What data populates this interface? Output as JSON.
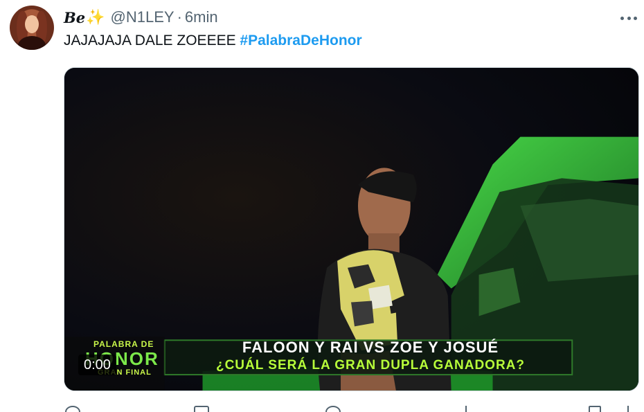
{
  "tweet": {
    "author": {
      "display_name": "Be",
      "emoji": "✨",
      "handle": "@N1LEY",
      "separator": "·",
      "time": "6min"
    },
    "text": "JAJAJAJA DALE ZOEEEE ",
    "hashtag": "#PalabraDeHonor",
    "media": {
      "type": "video",
      "timestamp": "0:00",
      "logo_top": "PALABRA DE",
      "logo_mid": "HONOR",
      "logo_bottom": "GRAN FINAL",
      "banner_line1": "FALOON Y RAI VS ZOE Y JOSUÉ",
      "banner_line2": "¿CUÁL SERÁ LA GRAN DUPLA GANADORA?"
    },
    "actions": {
      "reply_icon": "reply-icon",
      "retweet_icon": "retweet-icon",
      "like_icon": "heart-icon",
      "views_icon": "views-icon",
      "bookmark_icon": "bookmark-icon",
      "share_icon": "share-icon"
    }
  },
  "colors": {
    "accent": "#1d9bf0",
    "text": "#0f1419",
    "muted": "#536471",
    "banner_green": "#b8ff3a"
  }
}
